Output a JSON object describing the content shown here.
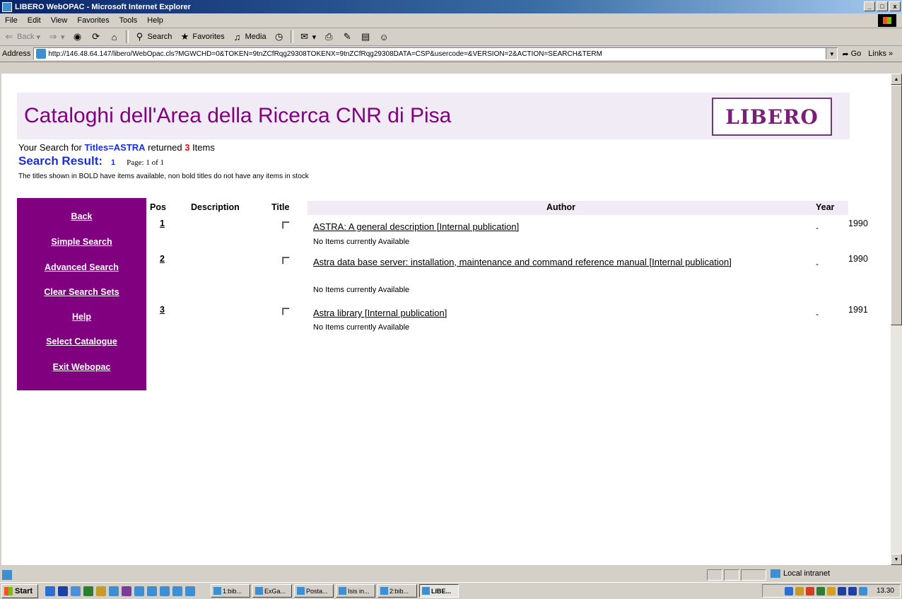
{
  "window": {
    "title": "LIBERO WebOPAC - Microsoft Internet Explorer",
    "buttons": [
      "_",
      "□",
      "x"
    ]
  },
  "menubar": [
    "File",
    "Edit",
    "View",
    "Favorites",
    "Tools",
    "Help"
  ],
  "toolbar": {
    "back": "Back",
    "search": "Search",
    "favorites": "Favorites",
    "media": "Media"
  },
  "addressbar": {
    "label": "Address",
    "url": "http://146.48.64.147/libero/WebOpac.cls?MGWCHD=0&TOKEN=9tnZCfRqg29308TOKENX=9tnZCfRqg29308DATA=CSP&usercode=&VERSION=2&ACTION=SEARCH&TERM",
    "go": "Go",
    "links": "Links"
  },
  "page": {
    "title": "Cataloghi dell'Area della Ricerca CNR di Pisa",
    "logo": "LIBERO",
    "search_prefix": "Your Search for ",
    "search_term": "Titles=ASTRA",
    "search_mid": " returned ",
    "search_count": "3",
    "search_suffix": " Items",
    "result_label": "Search Result:",
    "result_page_num": "1",
    "result_page_info": "Page: 1 of 1",
    "legend_note": "The titles shown in BOLD have items available, non bold titles do not have any items in stock"
  },
  "sidebar": {
    "items": [
      "Back",
      "Simple Search",
      "Advanced Search",
      "Clear Search Sets",
      "Help",
      "Select Catalogue",
      "Exit Webopac"
    ]
  },
  "results": {
    "columns": {
      "pos": "Pos",
      "description": "Description",
      "title": "Title",
      "author": "Author",
      "year": "Year"
    },
    "rows": [
      {
        "pos": "1",
        "title": "ASTRA: A general description [Internal publication]",
        "availability": "No Items currently Available",
        "author": "-",
        "year": "1990"
      },
      {
        "pos": "2",
        "title": "Astra data base server: installation, maintenance and command reference manual [Internal publication]",
        "availability": "No Items currently Available",
        "author": "-",
        "year": "1990"
      },
      {
        "pos": "3",
        "title": "Astra library [Internal publication]",
        "availability": "No Items currently Available",
        "author": "-",
        "year": "1991"
      }
    ]
  },
  "statusbar": {
    "zone": "Local intranet"
  },
  "taskbar": {
    "start": "Start",
    "tasks": [
      "1:bib...",
      "ExGa...",
      "Posta...",
      "Isis in...",
      "2:bib...",
      "LIBE..."
    ],
    "clock": "13.30"
  }
}
